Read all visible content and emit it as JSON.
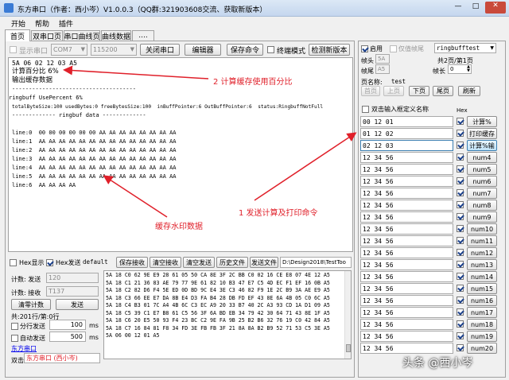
{
  "window": {
    "title": "东方串口（作者：西小岑）V1.0.0.3（QQ群:321903608交流、获取新版本）",
    "controls": [
      "—",
      "□",
      "✕"
    ]
  },
  "menu": [
    "开始",
    "帮助",
    "插件"
  ],
  "tabs": [
    "首页",
    "双串口页",
    "串口曲线页",
    "曲线数据",
    "...."
  ],
  "toolbar": {
    "show_port_label": "显示串口",
    "port_value": "COM7",
    "baud_value": "115200",
    "close_port": "关闭串口",
    "editor": "编辑器",
    "save_cmd": "保存命令",
    "terminal_mode": "终端模式",
    "check_new": "检测新版本"
  },
  "console_lines": [
    "5A 06 02 12 03 A5",
    "计算百分比 6%",
    "输出缓存数据",
    "-------------------------------------",
    "ringbuff UsePercent 6%",
    "totalByteSize:100 usedBytes:0 freeBytesSize:100  inBuffPointer:6 OutBuffPointer:6  status:RingbuffNotFull",
    "------------- ringbuf data -------------",
    "",
    "line:0  00 00 00 00 00 00 AA AA AA AA AA AA AA AA",
    "line:1  AA AA AA AA AA AA AA AA AA AA AA AA AA AA",
    "line:2  AA AA AA AA AA AA AA AA AA AA AA AA AA AA",
    "line:3  AA AA AA AA AA AA AA AA AA AA AA AA AA AA",
    "line:4  AA AA AA AA AA AA AA AA AA AA AA AA AA AA",
    "line:5  AA AA AA AA AA AA AA AA AA AA AA AA AA AA",
    "line:6  AA AA AA AA"
  ],
  "annotations": {
    "a1": "2 计算缓存使用百分比",
    "a2": "1 发送计算及打印命令",
    "a3": "缓存水印数据"
  },
  "bottom_bar": {
    "hex_show": "Hex显示",
    "hex_send": "Hex发送",
    "default": "default",
    "save_recv": "保存接收",
    "clear_recv": "清空接收",
    "clear_send": "清空发送",
    "history": "历史文件",
    "send_file": "发送文件",
    "path": "D:\\Design2018\\TestToo"
  },
  "stats": {
    "send_label": "计数: 发送",
    "send_value": "120",
    "recv_label": "计数: 接收",
    "recv_value": "T137",
    "clear_count": "清零计数",
    "send_btn": "发送",
    "total_line": "共:201行/第:0行",
    "split_send": "分行发送",
    "split_value": "100",
    "auto_send": "自动发送",
    "auto_value": "500",
    "ms": "ms",
    "link": "东方串口",
    "double_click": "双击",
    "double_click_value": "东方串口 (西小岑)"
  },
  "hex_lines": [
    "5A 18 C0 62 9E E9 28 61 05 50 CA 8E 3F 2C BB C0 02 16 CE E8 07 4E 12 A5",
    "5A 18 C1 21 36 83 AE 79 77 9E 61 82 10 B3 47 E7 C5 4D EC F1 EF 16 0B A5",
    "5A 18 C2 82 D6 F4 5E ED 0D BD 9C E4 3E C3 46 82 F9 1E 2C B9 3A AE E9 A5",
    "5A 18 C3 66 EE E7 DA 8B E4 D3 FA B4 28 DB FD EF 43 8E 6A 4B 05 C0 6C A5",
    "5A 18 C4 B3 01 7C A4 4B 6C C3 EC A9 20 33 B7 40 2C A3 93 CD 1A D1 09 A5",
    "5A 18 C5 39 C1 E7 B8 61 C5 56 3F 6A BD EB 34 79 42 30 64 71 43 8E 1F A5",
    "5A 18 C6 20 E5 50 93 F4 23 BC C2 9E FA 9B 25 B2 B6 32 76 19 C0 42 84 A5",
    "5A 18 C7 16 84 81 F8 34 FD 3E FB FB 3F 21 8A 8A B2 B9 52 71 53 C5 3E A5",
    "5A 06 00 12 01 A5"
  ],
  "right_panel": {
    "enable": "启用",
    "only_frame_tail": "仅值帧尾",
    "frame_head": "帧头",
    "frame_head_value": "5A",
    "frame_tail": "帧尾",
    "frame_tail_value": "A5",
    "profile": "ringbufftest",
    "page_info": "共2页/第1页",
    "frame_len_label": "帧长",
    "frame_len_value": "0",
    "page_name_label": "页名称:",
    "page_name_value": "test",
    "home": "首页",
    "prev": "上页",
    "next": "下页",
    "last": "尾页",
    "refresh": "刷新",
    "custom_name_label": "双击输入框定义名称",
    "hex_col": "Hex"
  },
  "commands": [
    {
      "value": "00 12 01",
      "hex": true,
      "label": "计算%"
    },
    {
      "value": "01 12 02",
      "hex": true,
      "label": "打印缓存"
    },
    {
      "value": "02 12 03",
      "hex": true,
      "label": "计算%输"
    },
    {
      "value": "12 34 56",
      "hex": true,
      "label": "num4"
    },
    {
      "value": "12 34 56",
      "hex": true,
      "label": "num5"
    },
    {
      "value": "12 34 56",
      "hex": true,
      "label": "num6"
    },
    {
      "value": "12 34 56",
      "hex": true,
      "label": "num7"
    },
    {
      "value": "12 34 56",
      "hex": true,
      "label": "num8"
    },
    {
      "value": "12 34 56",
      "hex": true,
      "label": "num9"
    },
    {
      "value": "12 34 56",
      "hex": true,
      "label": "num10"
    },
    {
      "value": "12 34 56",
      "hex": true,
      "label": "num11"
    },
    {
      "value": "12 34 56",
      "hex": true,
      "label": "num12"
    },
    {
      "value": "12 34 56",
      "hex": true,
      "label": "num13"
    },
    {
      "value": "12 34 56",
      "hex": true,
      "label": "num14"
    },
    {
      "value": "12 34 56",
      "hex": true,
      "label": "num15"
    },
    {
      "value": "12 34 56",
      "hex": true,
      "label": "num16"
    },
    {
      "value": "12 34 56",
      "hex": true,
      "label": "num17"
    },
    {
      "value": "12 34 56",
      "hex": true,
      "label": "num18"
    },
    {
      "value": "12 34 56",
      "hex": true,
      "label": "num19"
    },
    {
      "value": "12 34 56",
      "hex": true,
      "label": "num20"
    }
  ],
  "watermark": "头条 @西小岑",
  "colors": {
    "annotation_red": "#e0202a",
    "link_blue": "#0000ee",
    "titlebar": "#c9dcf2"
  }
}
